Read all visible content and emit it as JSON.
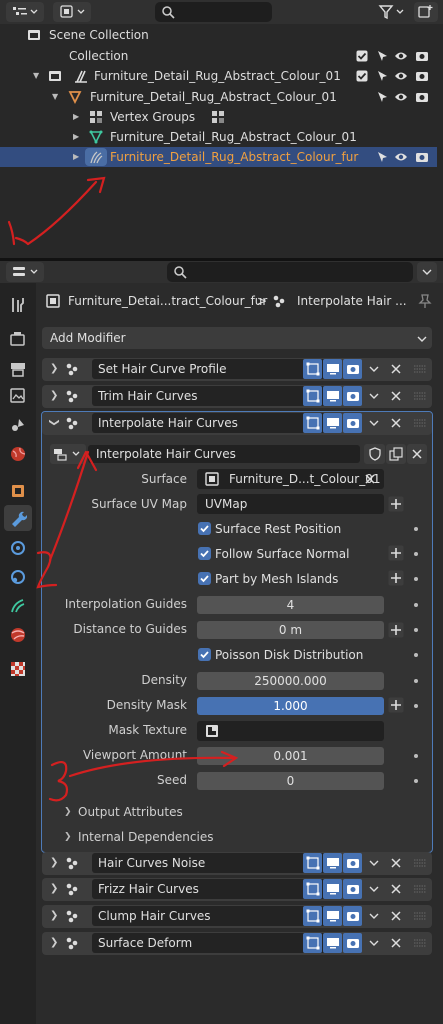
{
  "outliner": {
    "search_placeholder": "",
    "rows": [
      {
        "label": "Scene Collection"
      },
      {
        "label": "Collection"
      },
      {
        "label": "Furniture_Detail_Rug_Abstract_Colour_01"
      },
      {
        "label": "Furniture_Detail_Rug_Abstract_Colour_01"
      },
      {
        "label": "Vertex Groups"
      },
      {
        "label": "Furniture_Detail_Rug_Abstract_Colour_01"
      },
      {
        "label": "Furniture_Detail_Rug_Abstract_Colour_fur"
      }
    ]
  },
  "properties": {
    "breadcrumb_object": "Furniture_Detai...tract_Colour_fur",
    "breadcrumb_sep": ">",
    "breadcrumb_modifier": "Interpolate Hair ...",
    "add_modifier": "Add Modifier",
    "modifiers_top": [
      {
        "name": "Set Hair Curve Profile"
      },
      {
        "name": "Trim Hair Curves"
      },
      {
        "name": "Interpolate Hair Curves"
      }
    ],
    "panel": {
      "node_group": "Interpolate Hair Curves",
      "surface_label": "Surface",
      "surface_value": "Furniture_D...t_Colour_01",
      "uvmap_label": "Surface UV Map",
      "uvmap_value": "UVMap",
      "rest_position": "Surface Rest Position",
      "follow_normal": "Follow Surface Normal",
      "mesh_islands": "Part by Mesh Islands",
      "guides_label": "Interpolation Guides",
      "guides_value": "4",
      "distance_label": "Distance to Guides",
      "distance_value": "0 m",
      "poisson": "Poisson Disk Distribution",
      "density_label": "Density",
      "density_value": "250000.000",
      "density_mask_label": "Density Mask",
      "density_mask_value": "1.000",
      "mask_texture_label": "Mask Texture",
      "viewport_label": "Viewport Amount",
      "viewport_value": "0.001",
      "seed_label": "Seed",
      "seed_value": "0",
      "output_attributes": "Output Attributes",
      "internal_dependencies": "Internal Dependencies"
    },
    "modifiers_bottom": [
      {
        "name": "Hair Curves Noise"
      },
      {
        "name": "Frizz Hair Curves"
      },
      {
        "name": "Clump Hair Curves"
      },
      {
        "name": "Surface Deform"
      }
    ]
  },
  "colors": {
    "accent_blue": "#4772b3",
    "selection": "#334d80",
    "active_text": "#f0a040",
    "annotation_red": "#d42020"
  }
}
